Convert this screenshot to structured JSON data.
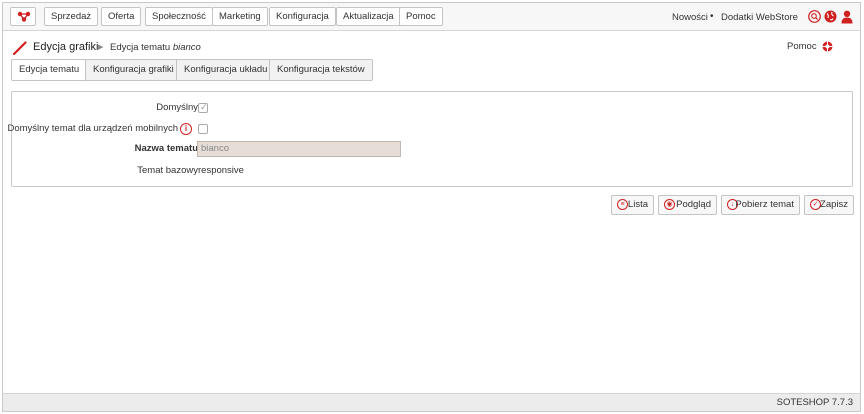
{
  "nav": {
    "items": [
      {
        "label": "Sprzedaż"
      },
      {
        "label": "Oferta"
      },
      {
        "label": "Społeczność"
      },
      {
        "label": "Marketing"
      },
      {
        "label": "Konfiguracja"
      },
      {
        "label": "Aktualizacja"
      },
      {
        "label": "Pomoc"
      }
    ],
    "news": "Nowości",
    "separator": "•",
    "addons": "Dodatki WebStore"
  },
  "breadcrumb": {
    "root": "Edycja grafiki",
    "separator": "▶",
    "current_prefix": "Edycja tematu",
    "current_name": "bianco"
  },
  "help": {
    "label": "Pomoc"
  },
  "tabs": [
    {
      "label": "Edycja tematu",
      "active": true
    },
    {
      "label": "Konfiguracja grafiki"
    },
    {
      "label": "Konfiguracja układu"
    },
    {
      "label": "Konfiguracja tekstów"
    }
  ],
  "form": {
    "default_label": "Domyślny",
    "default_checked": true,
    "mobile_label": "Domyślny temat dla urządzeń mobilnych",
    "mobile_checked": false,
    "name_label": "Nazwa tematu",
    "name_value": "bianco",
    "base_label": "Temat bazowy",
    "base_value": "responsive"
  },
  "actions": {
    "list": "Lista",
    "preview": "Podgląd",
    "download": "Pobierz temat",
    "save": "Zapisz"
  },
  "footer": {
    "version": "SOTESHOP 7.7.3"
  },
  "colors": {
    "accent": "#d02020"
  }
}
